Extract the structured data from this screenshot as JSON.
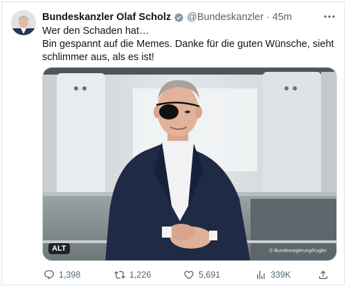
{
  "author": {
    "display_name": "Bundeskanzler Olaf Scholz",
    "handle": "@Bundeskanzler",
    "separator": "·",
    "time": "45m"
  },
  "tweet": {
    "lines": [
      "Wer den Schaden hat…",
      "Bin gespannt auf die Memes. Danke für die guten Wünsche, sieht",
      "schlimmer aus, als es ist!"
    ]
  },
  "media": {
    "alt_label": "ALT",
    "credit": "© Bundesregierung/Kugler"
  },
  "actions": {
    "replies": "1,398",
    "retweets": "1,226",
    "likes": "5,691",
    "views": "339K"
  },
  "colors": {
    "verified_badge": "#829aab",
    "secondary_text": "#536471",
    "suit": "#1f2a44",
    "eyepatch": "#111111"
  },
  "icons": [
    "verified-icon",
    "more-icon",
    "reply-icon",
    "retweet-icon",
    "like-icon",
    "views-icon",
    "share-icon"
  ]
}
